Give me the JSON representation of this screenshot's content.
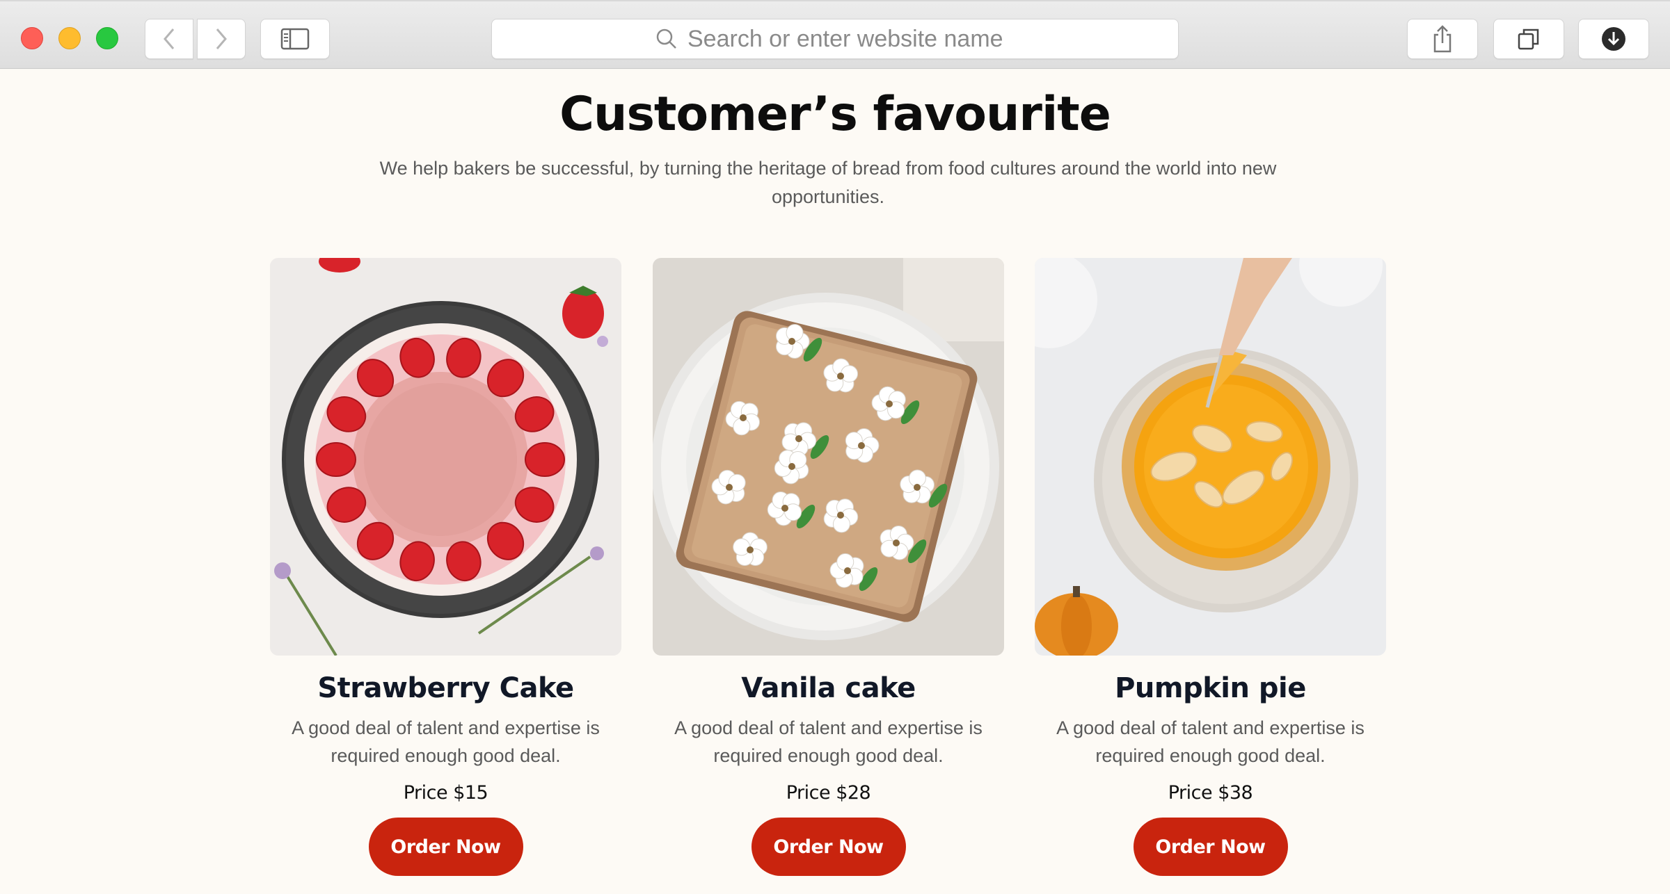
{
  "browser": {
    "search_placeholder": "Search or enter website name"
  },
  "section": {
    "title": "Customer’s favourite",
    "subtitle": "We help bakers be successful, by turning the heritage of bread from food cultures around the world into new opportunities."
  },
  "products": [
    {
      "name": "Strawberry Cake",
      "description": "A good deal of talent and expertise is required enough good deal.",
      "price": "Price $15",
      "button": "Order Now"
    },
    {
      "name": "Vanila cake",
      "description": "A good deal of talent and expertise is required enough good deal.",
      "price": "Price $28",
      "button": "Order Now"
    },
    {
      "name": "Pumpkin pie",
      "description": "A good deal of talent and expertise is required enough good deal.",
      "price": "Price $38",
      "button": "Order Now"
    }
  ],
  "colors": {
    "accent": "#c9240e",
    "page_background": "#fdfaf5",
    "heading": "#0d0d0d"
  }
}
